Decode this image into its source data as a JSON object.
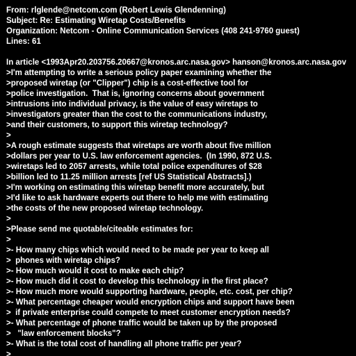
{
  "header": {
    "from": "From: rlglende@netcom.com (Robert Lewis Glendenning)",
    "subject": "Subject: Re: Estimating Wiretap Costs/Benefits",
    "organization": "Organization: Netcom - Online Communication Services (408 241-9760 guest)",
    "lines": "Lines: 61"
  },
  "attribution": "In article <1993Apr20.203756.20667@kronos.arc.nasa.gov> hanson@kronos.arc.nasa.gov",
  "quoted": [
    ">I'm attempting to write a serious policy paper examining whether the",
    ">proposed wiretap (or \"Clipper\") chip is a cost-effective tool for",
    ">police investigation.  That is, ignoring concerns about government",
    ">intrusions into individual privacy, is the value of easy wiretaps to",
    ">investigators greater than the cost to the communications industry,",
    ">and their customers, to support this wiretap technology?",
    ">",
    ">A rough estimate suggests that wiretaps are worth about five million",
    ">dollars per year to U.S. law enforcement agencies.  (In 1990, 872 U.S.",
    ">wiretaps led to 2057 arrests, while total police expenditures of $28",
    ">billion led to 11.25 million arrests [ref US Statistical Abstracts].)",
    ">I'm working on estimating this wiretap benefit more accurately, but",
    ">I'd like to ask hardware experts out there to help me with estimating",
    ">the costs of the new proposed wiretap technology.",
    ">",
    ">Please send me quotable/citeable estimates for:",
    ">",
    ">- How many chips which would need to be made per year to keep all",
    ">  phones with wiretap chips?",
    ">- How much would it cost to make each chip?",
    ">- How much did it cost to develop this technology in the first place?",
    ">- How much more would supporting hardware, people, etc. cost, per chip?",
    ">- What percentage cheaper would encryption chips and support have been",
    ">  if private enterprise could compete to meet customer encryption needs?",
    ">- What percentage of phone traffic would be taken up by the proposed",
    ">   \"law enforcement blocks\"?",
    ">- What is the total cost of handling all phone traffic per year?",
    ">"
  ]
}
